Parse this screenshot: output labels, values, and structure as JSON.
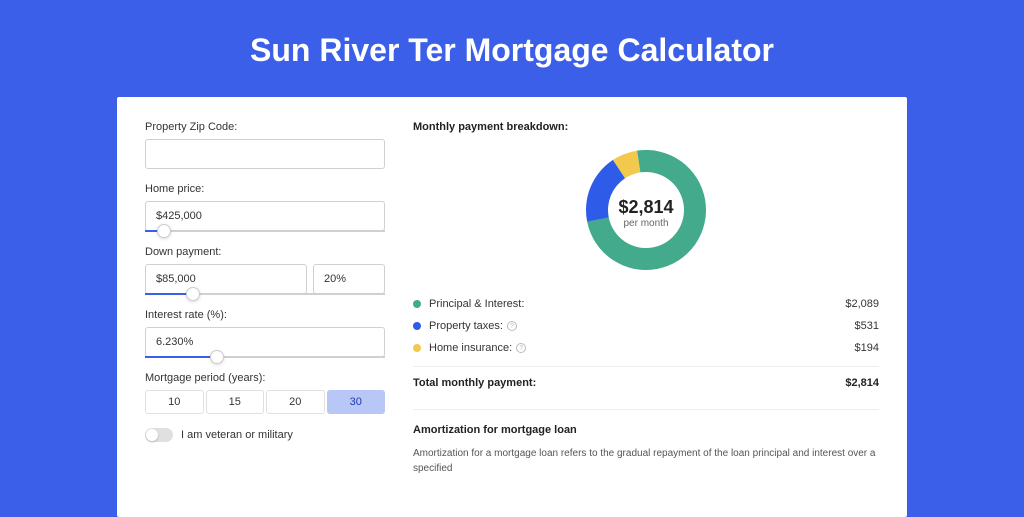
{
  "hero": {
    "title": "Sun River Ter Mortgage Calculator"
  },
  "colors": {
    "principal": "#43aa8b",
    "taxes": "#2e5be8",
    "insurance": "#f2c94c"
  },
  "form": {
    "zip": {
      "label": "Property Zip Code:",
      "value": ""
    },
    "home_price": {
      "label": "Home price:",
      "value": "$425,000",
      "slider_pct": 8
    },
    "down_payment": {
      "label": "Down payment:",
      "value": "$85,000",
      "pct_value": "20%",
      "slider_pct": 20
    },
    "interest_rate": {
      "label": "Interest rate (%):",
      "value": "6.230%",
      "slider_pct": 30
    },
    "mortgage_period": {
      "label": "Mortgage period (years):",
      "options": [
        "10",
        "15",
        "20",
        "30"
      ],
      "selected": "30"
    },
    "veteran": {
      "label": "I am veteran or military",
      "checked": false
    }
  },
  "breakdown": {
    "title": "Monthly payment breakdown:",
    "center_amount": "$2,814",
    "center_sub": "per month",
    "items": [
      {
        "key": "principal",
        "label": "Principal & Interest:",
        "value": "$2,089",
        "info": false,
        "color": "#43aa8b"
      },
      {
        "key": "taxes",
        "label": "Property taxes:",
        "value": "$531",
        "info": true,
        "color": "#2e5be8"
      },
      {
        "key": "insurance",
        "label": "Home insurance:",
        "value": "$194",
        "info": true,
        "color": "#f2c94c"
      }
    ],
    "total_label": "Total monthly payment:",
    "total_value": "$2,814"
  },
  "chart_data": {
    "type": "pie",
    "title": "Monthly payment breakdown",
    "series": [
      {
        "name": "Principal & Interest",
        "value": 2089
      },
      {
        "name": "Property taxes",
        "value": 531
      },
      {
        "name": "Home insurance",
        "value": 194
      }
    ],
    "total": 2814
  },
  "amortization": {
    "title": "Amortization for mortgage loan",
    "body": "Amortization for a mortgage loan refers to the gradual repayment of the loan principal and interest over a specified"
  }
}
